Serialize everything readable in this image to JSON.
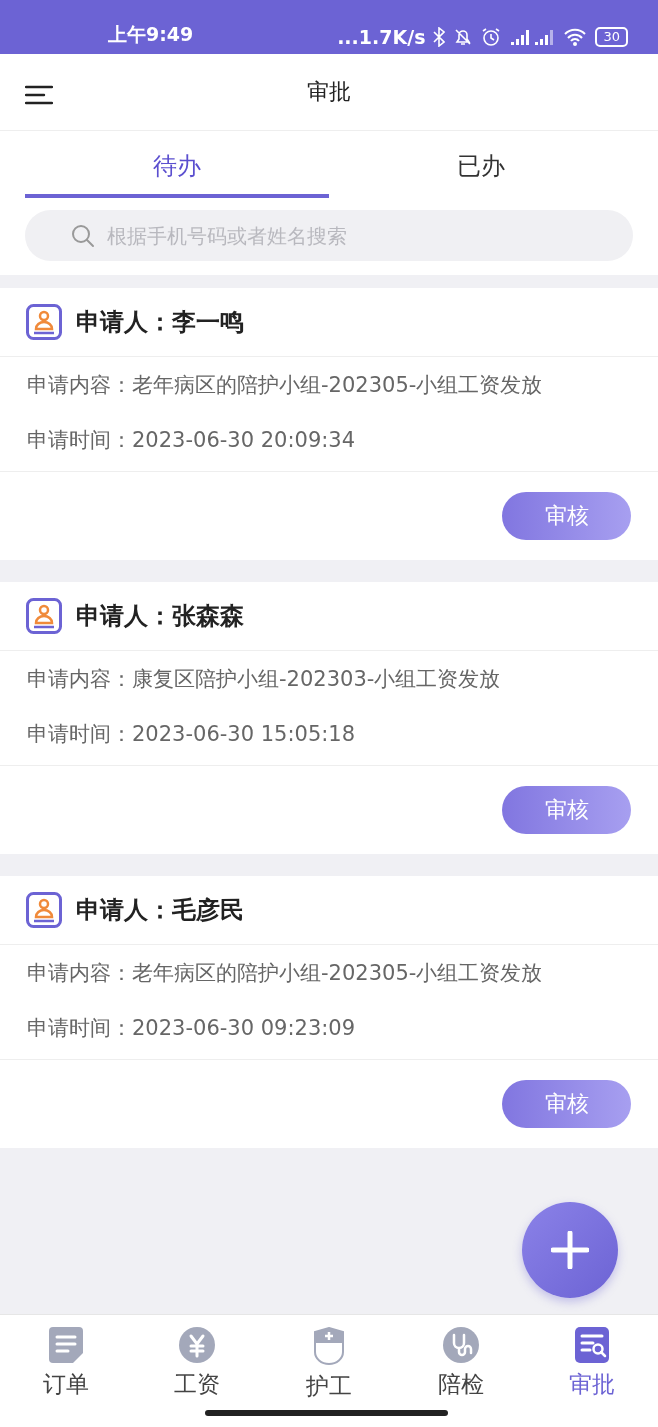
{
  "status_bar": {
    "time": "上午9:49",
    "speed": "...1.7K/s",
    "battery": "30"
  },
  "header": {
    "title": "审批"
  },
  "tabs": [
    {
      "label": "待办",
      "selected": true
    },
    {
      "label": "已办",
      "selected": false
    }
  ],
  "search": {
    "placeholder": "根据手机号码或者姓名搜索"
  },
  "cards": [
    {
      "applicant": "申请人：李一鸣",
      "content": "申请内容：老年病区的陪护小组-202305-小组工资发放",
      "time": "申请时间：2023-06-30 20:09:34",
      "action": "审核"
    },
    {
      "applicant": "申请人：张森森",
      "content": "申请内容：康复区陪护小组-202303-小组工资发放",
      "time": "申请时间：2023-06-30 15:05:18",
      "action": "审核"
    },
    {
      "applicant": "申请人：毛彦民",
      "content": "申请内容：老年病区的陪护小组-202305-小组工资发放",
      "time": "申请时间：2023-06-30 09:23:09",
      "action": "审核"
    }
  ],
  "nav": [
    {
      "kind": "orders",
      "label": "订单",
      "selected": false
    },
    {
      "kind": "salary",
      "label": "工资",
      "selected": false
    },
    {
      "kind": "carer",
      "label": "护工",
      "selected": false
    },
    {
      "kind": "escort",
      "label": "陪检",
      "selected": false
    },
    {
      "kind": "approval",
      "label": "审批",
      "selected": true
    }
  ]
}
